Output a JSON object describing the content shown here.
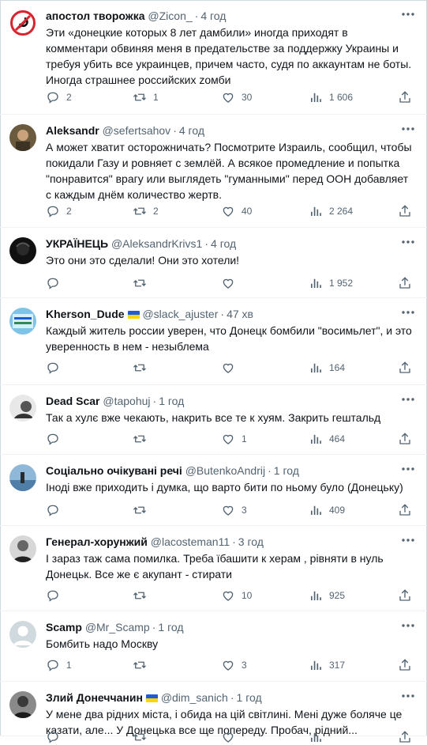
{
  "tweets": [
    {
      "author": "апостол творожка",
      "handle": "@Zicon_",
      "time": "4 год",
      "text": "Эти «донецкие которых 8 лет дамбили» иногда приходят в комментари обвиняя меня в предательстве за поддержку Украины и требуя убить все украинцев, причем часто, судя по аккаунтам не боты. Иногда страшнее российских zомби",
      "replies": "2",
      "retweets": "1",
      "likes": "30",
      "views": "1 606",
      "avatar": "anti-symbol",
      "flag": false
    },
    {
      "author": "Aleksandr",
      "handle": "@sefertsahov",
      "time": "4 год",
      "text": "А может хватит осторожничать? Посмотрите Израиль, сообщил, чтобы покидали Газу и ровняет с землёй. А всякое промедление и попытка \"понравится\" врагу или выглядеть \"гуманными\" перед ООН добавляет с каждым днём количество жертв.",
      "replies": "2",
      "retweets": "2",
      "likes": "40",
      "views": "2 264",
      "avatar": "photo",
      "flag": false
    },
    {
      "author": "УКРАЇНЕЦЬ",
      "handle": "@AleksandrKrivs1",
      "time": "4 год",
      "text": "Это они это сделали! Они это хотели!",
      "replies": "",
      "retweets": "",
      "likes": "",
      "views": "1 952",
      "avatar": "dark",
      "flag": false
    },
    {
      "author": "Kherson_Dude",
      "handle": "@slack_ajuster",
      "time": "47 хв",
      "text": "Каждый житель россии уверен, что Донецк бомбили \"восимьлет\", и это уверенность в нем - незыблема",
      "replies": "",
      "retweets": "",
      "likes": "",
      "views": "164",
      "avatar": "kherson",
      "flag": true
    },
    {
      "author": "Dead Scar",
      "handle": "@tapohuj",
      "time": "1 год",
      "text": "Так а хулє вже чекають, накрить все те к хуям. Закрить гештальд",
      "replies": "",
      "retweets": "",
      "likes": "1",
      "views": "464",
      "avatar": "bw-photo",
      "flag": false
    },
    {
      "author": "Соціально очікувані речі",
      "handle": "@ButenkoAndrij",
      "time": "1 год",
      "text": "Іноді вже приходить і думка, що варто бити по ньому було (Донецьку)",
      "replies": "",
      "retweets": "",
      "likes": "3",
      "views": "409",
      "avatar": "sea",
      "flag": false
    },
    {
      "author": "Генерал-хорунжий",
      "handle": "@lacosteman11",
      "time": "3 год",
      "text": "І зараз таж сама помилка. Треба їбашити к херам , рівняти в нуль Донецьк. Все же є акупант - стирати",
      "replies": "",
      "retweets": "",
      "likes": "10",
      "views": "925",
      "avatar": "portrait",
      "flag": false
    },
    {
      "author": "Scamp",
      "handle": "@Mr_Scamp",
      "time": "1 год",
      "text": "Бомбить надо Москву",
      "replies": "1",
      "retweets": "",
      "likes": "3",
      "views": "317",
      "avatar": "default",
      "flag": false
    },
    {
      "author": "Злий Донеччанин",
      "handle": "@dim_sanich",
      "time": "1 год",
      "text": "У мене два рідних міста, і обида на цій світлині. Мені дуже боляче це казати, але... У Донецька все ще попереду. Пробач, рідний...",
      "replies": "",
      "retweets": "",
      "likes": "",
      "views": "",
      "avatar": "portrait2",
      "flag": true
    }
  ]
}
